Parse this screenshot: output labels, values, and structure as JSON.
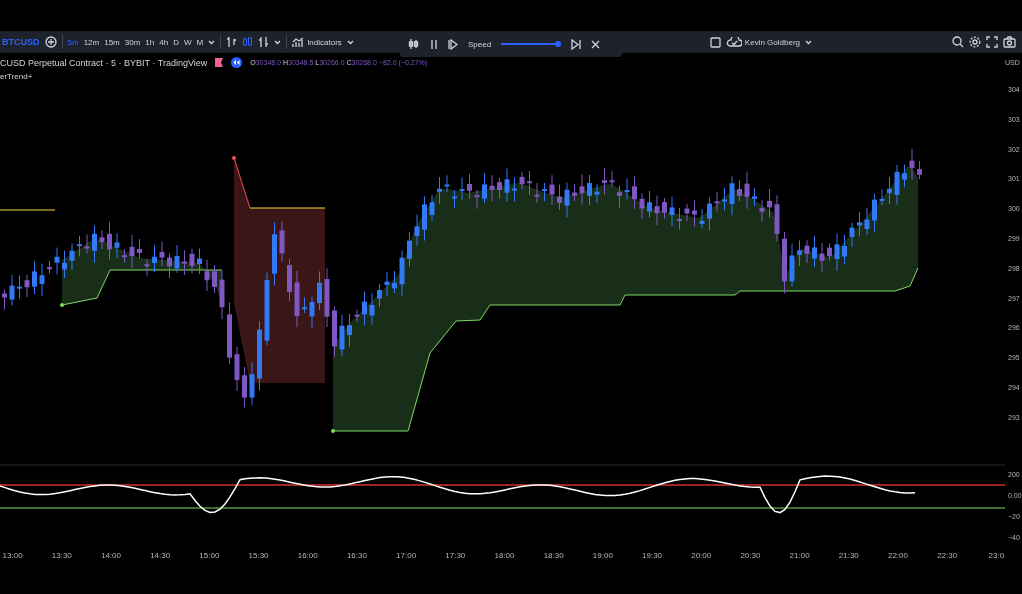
{
  "toolbar": {
    "symbol": "BTCUSD",
    "timeframes": [
      {
        "label": "5m",
        "selected": true
      },
      {
        "label": "12m",
        "selected": false
      },
      {
        "label": "15m",
        "selected": false
      },
      {
        "label": "30m",
        "selected": false
      },
      {
        "label": "1h",
        "selected": false
      },
      {
        "label": "4h",
        "selected": false
      },
      {
        "label": "D",
        "selected": false
      },
      {
        "label": "W",
        "selected": false
      },
      {
        "label": "M",
        "selected": false
      }
    ],
    "indicators": "Indicators",
    "user": "Kevin Goldberg"
  },
  "replay": {
    "speed_label": "Speed",
    "level": 0.95
  },
  "legend": {
    "title": "CUSD Perpetual Contract · 5 · BYBIT · TradingView",
    "ohlc": [
      {
        "key": "O",
        "value": "30348.0"
      },
      {
        "key": "H",
        "value": "30348.5"
      },
      {
        "key": "L",
        "value": "30266.0"
      },
      {
        "key": "C",
        "value": "30268.0"
      }
    ],
    "change": "−82.0 (−0.27%)",
    "indicator": "erTrend+"
  },
  "price_axis": {
    "unit": "USD",
    "labels": [
      "304",
      "303",
      "302",
      "301",
      "300",
      "299",
      "298",
      "297",
      "296",
      "295",
      "294",
      "293"
    ]
  },
  "oscillator_axis": {
    "labels": [
      "200",
      "0.00",
      "−20",
      "−40"
    ]
  },
  "time_axis": {
    "labels": [
      "13:00",
      "13:30",
      "14:00",
      "14:30",
      "15:00",
      "15:30",
      "16:00",
      "16:30",
      "17:00",
      "17:30",
      "18:00",
      "18:30",
      "19:00",
      "19:30",
      "20:00",
      "20:30",
      "21:00",
      "21:30",
      "22:00",
      "22:30",
      "23:0"
    ]
  }
}
